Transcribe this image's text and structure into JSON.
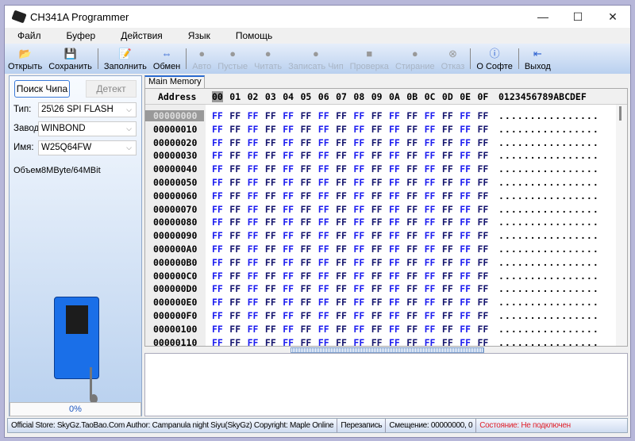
{
  "window": {
    "title": "CH341A Programmer",
    "controls": {
      "minimize": "—",
      "maximize": "☐",
      "close": "✕"
    }
  },
  "menu": [
    "Файл",
    "Буфер",
    "Действия",
    "Язык",
    "Помощь"
  ],
  "toolbar": [
    {
      "label": "Открыть",
      "icon": "open-folder-icon",
      "glyph": "📂",
      "enabled": true
    },
    {
      "label": "Сохранить",
      "icon": "save-icon",
      "glyph": "💾",
      "enabled": true
    },
    {
      "sep": true
    },
    {
      "label": "Заполнить",
      "icon": "fill-icon",
      "glyph": "📝",
      "enabled": true
    },
    {
      "label": "Обмен",
      "icon": "swap-icon",
      "glyph": "⇔",
      "enabled": true
    },
    {
      "sep": true
    },
    {
      "label": "Авто",
      "icon": "auto-icon",
      "glyph": "●",
      "enabled": false
    },
    {
      "label": "Пустые",
      "icon": "blank-check-icon",
      "glyph": "●",
      "enabled": false
    },
    {
      "label": "Читать",
      "icon": "read-icon",
      "glyph": "●",
      "enabled": false
    },
    {
      "label": "Записать Чип",
      "icon": "write-icon",
      "glyph": "●",
      "enabled": false
    },
    {
      "label": "Проверка",
      "icon": "verify-icon",
      "glyph": "■",
      "enabled": false
    },
    {
      "label": "Стирание",
      "icon": "erase-icon",
      "glyph": "●",
      "enabled": false
    },
    {
      "label": "Отказ",
      "icon": "cancel-icon",
      "glyph": "⊗",
      "enabled": false
    },
    {
      "sep": true
    },
    {
      "label": "О Софте",
      "icon": "info-icon",
      "glyph": "ⓘ",
      "enabled": true
    },
    {
      "sep": true
    },
    {
      "label": "Выход",
      "icon": "exit-icon",
      "glyph": "⇤",
      "enabled": true
    }
  ],
  "left": {
    "search_button": "Поиск Чипа",
    "detect_button": "Детект",
    "type_label": "Тип:",
    "type_value": "25\\26 SPI FLASH",
    "maker_label": "Завод:",
    "maker_value": "WINBOND",
    "name_label": "Имя:",
    "name_value": "W25Q64FW",
    "size_text": "Объем8MByte/64MBit",
    "progress_text": "0%",
    "progress_value": 0
  },
  "tab": "Main Memory",
  "hex": {
    "address_header": "Address",
    "columns": [
      "00",
      "01",
      "02",
      "03",
      "04",
      "05",
      "06",
      "07",
      "08",
      "09",
      "0A",
      "0B",
      "0C",
      "0D",
      "0E",
      "0F"
    ],
    "ascii_header": "0123456789ABCDEF",
    "rows": [
      {
        "addr": "00000000",
        "bytes": "FF FF FF FF FF FF FF FF FF FF FF FF FF FF FF FF",
        "ascii": "................"
      },
      {
        "addr": "00000010",
        "bytes": "FF FF FF FF FF FF FF FF FF FF FF FF FF FF FF FF",
        "ascii": "................"
      },
      {
        "addr": "00000020",
        "bytes": "FF FF FF FF FF FF FF FF FF FF FF FF FF FF FF FF",
        "ascii": "................"
      },
      {
        "addr": "00000030",
        "bytes": "FF FF FF FF FF FF FF FF FF FF FF FF FF FF FF FF",
        "ascii": "................"
      },
      {
        "addr": "00000040",
        "bytes": "FF FF FF FF FF FF FF FF FF FF FF FF FF FF FF FF",
        "ascii": "................"
      },
      {
        "addr": "00000050",
        "bytes": "FF FF FF FF FF FF FF FF FF FF FF FF FF FF FF FF",
        "ascii": "................"
      },
      {
        "addr": "00000060",
        "bytes": "FF FF FF FF FF FF FF FF FF FF FF FF FF FF FF FF",
        "ascii": "................"
      },
      {
        "addr": "00000070",
        "bytes": "FF FF FF FF FF FF FF FF FF FF FF FF FF FF FF FF",
        "ascii": "................"
      },
      {
        "addr": "00000080",
        "bytes": "FF FF FF FF FF FF FF FF FF FF FF FF FF FF FF FF",
        "ascii": "................"
      },
      {
        "addr": "00000090",
        "bytes": "FF FF FF FF FF FF FF FF FF FF FF FF FF FF FF FF",
        "ascii": "................"
      },
      {
        "addr": "000000A0",
        "bytes": "FF FF FF FF FF FF FF FF FF FF FF FF FF FF FF FF",
        "ascii": "................"
      },
      {
        "addr": "000000B0",
        "bytes": "FF FF FF FF FF FF FF FF FF FF FF FF FF FF FF FF",
        "ascii": "................"
      },
      {
        "addr": "000000C0",
        "bytes": "FF FF FF FF FF FF FF FF FF FF FF FF FF FF FF FF",
        "ascii": "................"
      },
      {
        "addr": "000000D0",
        "bytes": "FF FF FF FF FF FF FF FF FF FF FF FF FF FF FF FF",
        "ascii": "................"
      },
      {
        "addr": "000000E0",
        "bytes": "FF FF FF FF FF FF FF FF FF FF FF FF FF FF FF FF",
        "ascii": "................"
      },
      {
        "addr": "000000F0",
        "bytes": "FF FF FF FF FF FF FF FF FF FF FF FF FF FF FF FF",
        "ascii": "................"
      },
      {
        "addr": "00000100",
        "bytes": "FF FF FF FF FF FF FF FF FF FF FF FF FF FF FF FF",
        "ascii": "................"
      },
      {
        "addr": "00000110",
        "bytes": "FF FF FF FF FF FF FF FF FF FF FF FF FF FF FF FF",
        "ascii": "................"
      }
    ]
  },
  "status": {
    "info": "Official Store: SkyGz.TaoBao.Com Author: Campanula night Siyu(SkyGz) Copyright: Maple Online",
    "mode": "Перезапись",
    "offset": "Смещение: 00000000, 0",
    "state": "Состояние: Не подключен"
  },
  "colors": {
    "hex_even": "#1c1cf0",
    "hex_odd": "#14146e",
    "state": "#e0202a"
  }
}
